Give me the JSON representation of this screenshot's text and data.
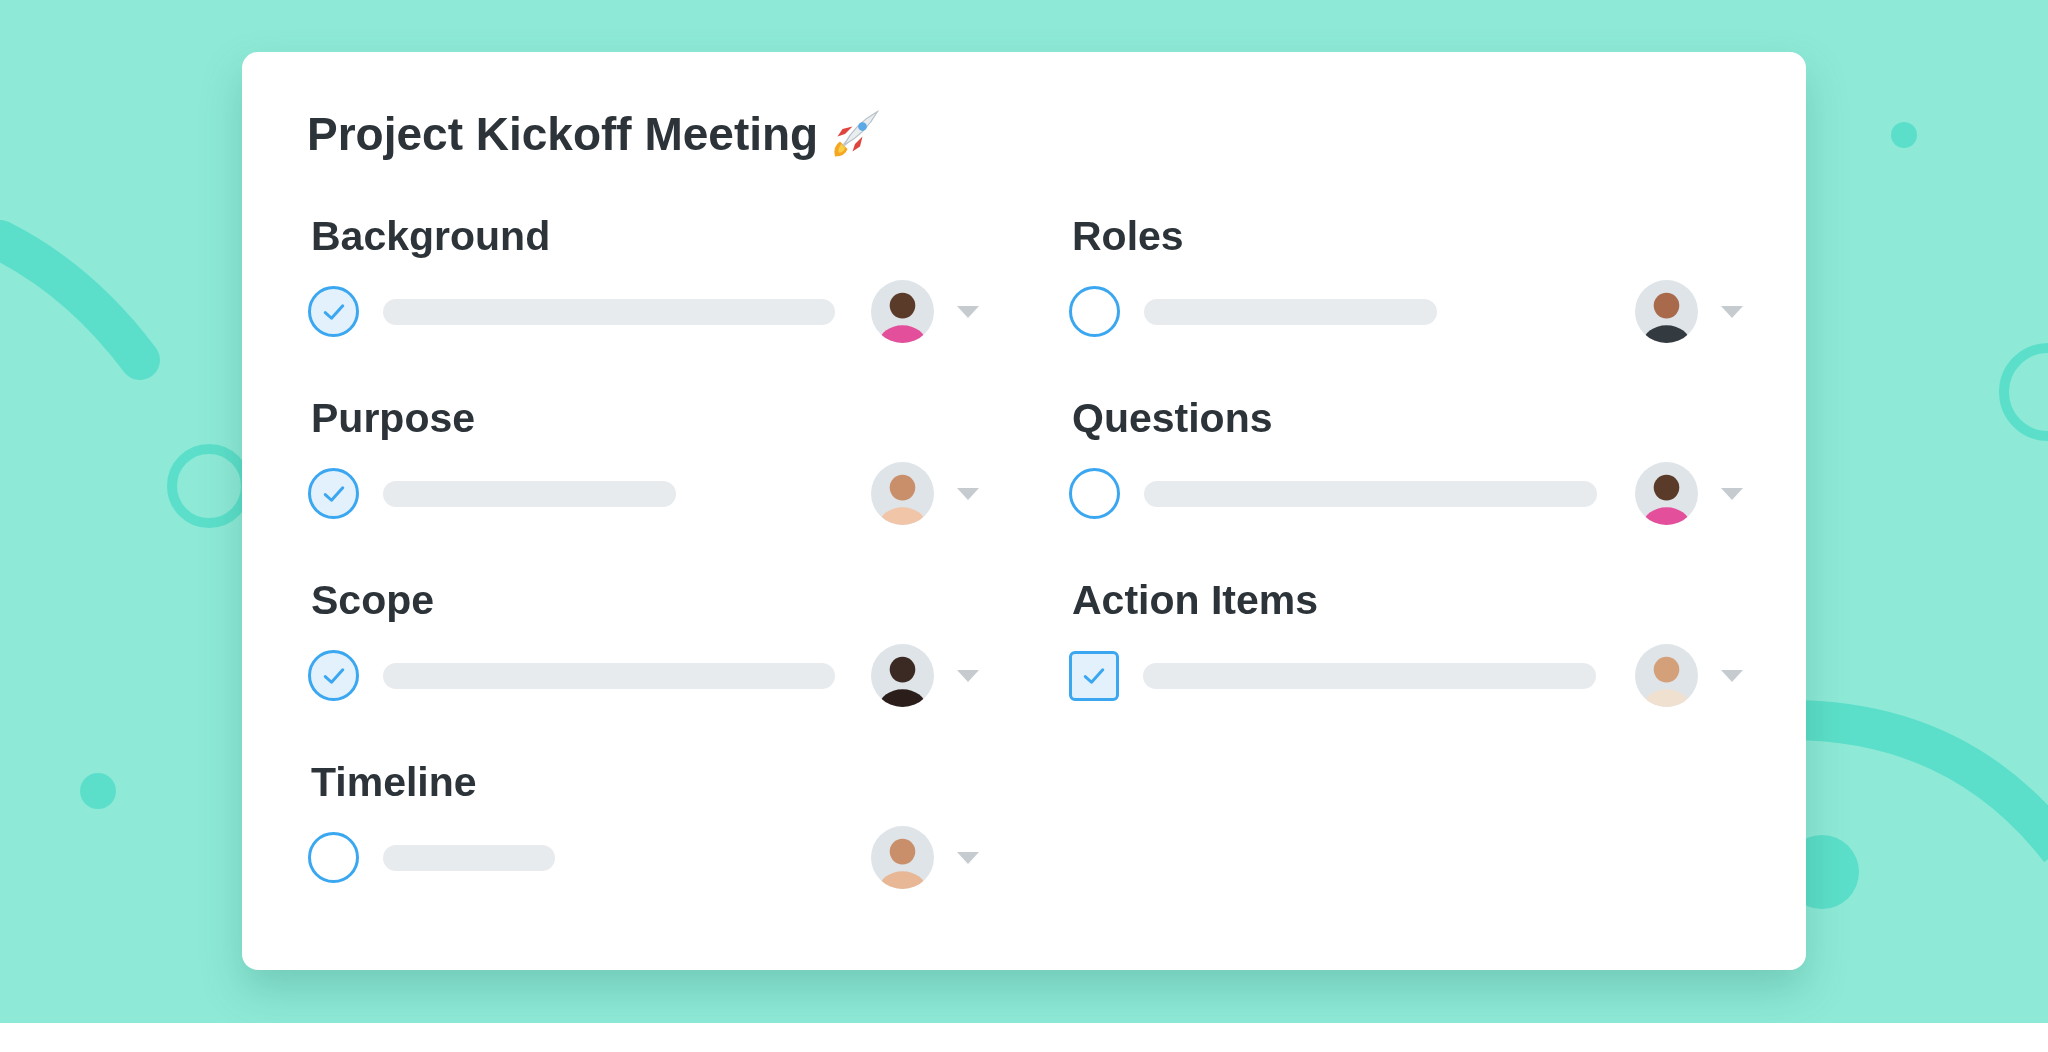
{
  "title": "Project Kickoff Meeting",
  "columns": [
    {
      "sections": [
        {
          "label": "Background",
          "kind": "circle",
          "checked": true
        },
        {
          "label": "Purpose",
          "kind": "circle",
          "checked": true
        },
        {
          "label": "Scope",
          "kind": "circle",
          "checked": true
        },
        {
          "label": "Timeline",
          "kind": "circle",
          "checked": false
        }
      ]
    },
    {
      "sections": [
        {
          "label": "Roles",
          "kind": "circle",
          "checked": false
        },
        {
          "label": "Questions",
          "kind": "circle",
          "checked": false
        },
        {
          "label": "Action Items",
          "kind": "square",
          "checked": true
        }
      ]
    }
  ]
}
